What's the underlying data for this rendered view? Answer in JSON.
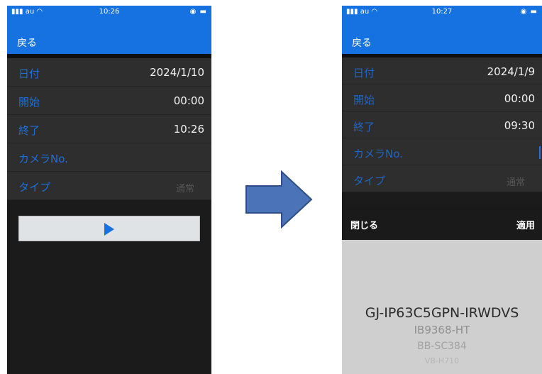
{
  "left": {
    "status": {
      "carrier": "au",
      "time": "10:26"
    },
    "back_label": "戻る",
    "rows": [
      {
        "label": "日付",
        "value": "2024/1/10"
      },
      {
        "label": "開始",
        "value": "00:00"
      },
      {
        "label": "終了",
        "value": "10:26"
      },
      {
        "label": "カメラNo.",
        "value": ""
      },
      {
        "label": "タイプ",
        "value": "通常"
      }
    ]
  },
  "right": {
    "status": {
      "carrier": "au",
      "time": "10:27"
    },
    "back_label": "戻る",
    "rows": [
      {
        "label": "日付",
        "value": "2024/1/9"
      },
      {
        "label": "開始",
        "value": "00:00"
      },
      {
        "label": "終了",
        "value": "09:30"
      },
      {
        "label": "カメラNo.",
        "value": ""
      },
      {
        "label": "タイプ",
        "value": "通常"
      }
    ],
    "picker_bar": {
      "close_label": "閉じる",
      "apply_label": "適用"
    },
    "picker_options": [
      "GJ-IP63C5GPN-IRWDVS",
      "IB9368-HT",
      "BB-SC384",
      "VB-H710"
    ]
  },
  "colors": {
    "accent": "#1572e0",
    "label": "#1e6fdc",
    "row_bg": "#2e2e2e"
  }
}
